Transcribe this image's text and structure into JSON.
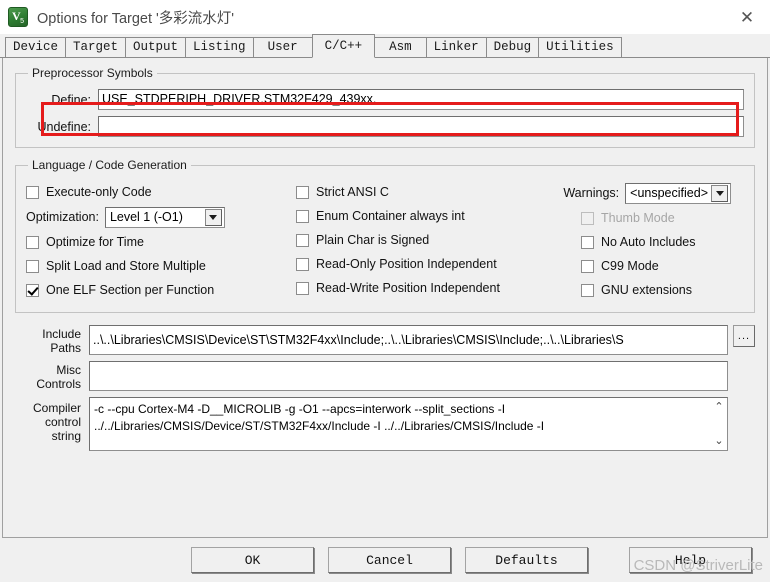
{
  "window": {
    "title": "Options for Target '多彩流水灯'",
    "icon": "keil-uvision5-icon",
    "close_label": "✕"
  },
  "tabs": [
    {
      "label": "Device",
      "active": false
    },
    {
      "label": "Target",
      "active": false
    },
    {
      "label": "Output",
      "active": false
    },
    {
      "label": "Listing",
      "active": false
    },
    {
      "label": "User",
      "active": false
    },
    {
      "label": "C/C++",
      "active": true
    },
    {
      "label": "Asm",
      "active": false
    },
    {
      "label": "Linker",
      "active": false
    },
    {
      "label": "Debug",
      "active": false
    },
    {
      "label": "Utilities",
      "active": false
    }
  ],
  "preprocessor": {
    "legend": "Preprocessor Symbols",
    "define_label": "Define:",
    "define_value": "USE_STDPERIPH_DRIVER,STM32F429_439xx,",
    "undefine_label": "Undefine:",
    "undefine_value": "",
    "highlight_color": "#e51b1b"
  },
  "language": {
    "legend": "Language / Code Generation",
    "col_left": [
      {
        "label": "Execute-only Code",
        "checked": false,
        "disabled": false
      },
      {
        "label": "Optimize for Time",
        "checked": false,
        "disabled": false
      },
      {
        "label": "Split Load and Store Multiple",
        "checked": false,
        "disabled": false
      },
      {
        "label": "One ELF Section per Function",
        "checked": true,
        "disabled": false
      }
    ],
    "optimization_label": "Optimization:",
    "optimization_value": "Level 1 (-O1)",
    "col_mid": [
      {
        "label": "Strict ANSI C",
        "checked": false,
        "disabled": false
      },
      {
        "label": "Enum Container always int",
        "checked": false,
        "disabled": false
      },
      {
        "label": "Plain Char is Signed",
        "checked": false,
        "disabled": false
      },
      {
        "label": "Read-Only Position Independent",
        "checked": false,
        "disabled": false
      },
      {
        "label": "Read-Write Position Independent",
        "checked": false,
        "disabled": false
      }
    ],
    "warnings_label": "Warnings:",
    "warnings_value": "<unspecified>",
    "col_right": [
      {
        "label": "Thumb Mode",
        "checked": false,
        "disabled": true
      },
      {
        "label": "No Auto Includes",
        "checked": false,
        "disabled": false
      },
      {
        "label": "C99 Mode",
        "checked": false,
        "disabled": false
      },
      {
        "label": "GNU extensions",
        "checked": false,
        "disabled": false
      }
    ]
  },
  "paths": {
    "include_label_line1": "Include",
    "include_label_line2": "Paths",
    "include_value": "..\\..\\Libraries\\CMSIS\\Device\\ST\\STM32F4xx\\Include;..\\..\\Libraries\\CMSIS\\Include;..\\..\\Libraries\\S",
    "browse_label": "...",
    "misc_label_line1": "Misc",
    "misc_label_line2": "Controls",
    "misc_value": "",
    "compiler_label_line1": "Compiler",
    "compiler_label_line2": "control",
    "compiler_label_line3": "string",
    "compiler_value_line1": "-c --cpu Cortex-M4 -D__MICROLIB -g -O1 --apcs=interwork --split_sections -I",
    "compiler_value_line2": "../../Libraries/CMSIS/Device/ST/STM32F4xx/Include -I ../../Libraries/CMSIS/Include -I",
    "scroll_up": "⌃",
    "scroll_down": "⌄"
  },
  "footer": {
    "ok": "OK",
    "cancel": "Cancel",
    "defaults": "Defaults",
    "help": "Help"
  },
  "watermark": "CSDN @StriverLite"
}
